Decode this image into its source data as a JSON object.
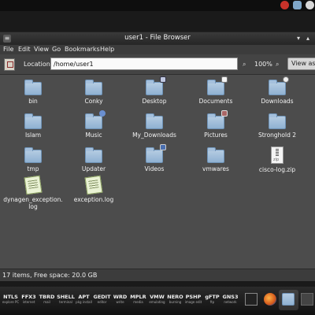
{
  "window": {
    "title": "user1 - File Browser",
    "minimize_glyph": "▾",
    "maximize_glyph": "▴",
    "menu_glyph": "≡"
  },
  "menu": [
    "File",
    "Edit",
    "View",
    "Go",
    "Bookmarks",
    "Help"
  ],
  "location": {
    "label": "Location:",
    "value": "/home/user1",
    "zoom_out": "⌕",
    "zoom_in": "⌕",
    "zoom": "100%",
    "view_button": "View as Icons"
  },
  "items": [
    {
      "label": "bin",
      "type": "folder"
    },
    {
      "label": "Conky",
      "type": "folder"
    },
    {
      "label": "Desktop",
      "type": "folder"
    },
    {
      "label": "Documents",
      "type": "folder"
    },
    {
      "label": "Downloads",
      "type": "folder"
    },
    {
      "label": "Islam",
      "type": "folder"
    },
    {
      "label": "Music",
      "type": "folder"
    },
    {
      "label": "My_Downloads",
      "type": "folder"
    },
    {
      "label": "Pictures",
      "type": "folder"
    },
    {
      "label": "Stronghold 2",
      "type": "folder"
    },
    {
      "label": "tmp",
      "type": "folder"
    },
    {
      "label": "Updater",
      "type": "folder"
    },
    {
      "label": "Videos",
      "type": "folder"
    },
    {
      "label": "vmwares",
      "type": "folder"
    },
    {
      "label": "cisco-log.zip",
      "type": "zip"
    },
    {
      "label": "dynagen_exception.\nlog",
      "type": "log"
    },
    {
      "label": "exception.log",
      "type": "log"
    }
  ],
  "status": "17 items, Free space: 20.0 GB",
  "taskbar": {
    "launchers": [
      {
        "name": "NTLS",
        "sub": "explore PC"
      },
      {
        "name": "FFX3",
        "sub": "internet"
      },
      {
        "name": "TBRD",
        "sub": "mail"
      },
      {
        "name": "SHELL",
        "sub": "terminal"
      },
      {
        "name": "APT",
        "sub": "pkg install"
      },
      {
        "name": "GEDIT",
        "sub": "editor"
      },
      {
        "name": "WRD",
        "sub": "write"
      },
      {
        "name": "MPLR",
        "sub": "media"
      },
      {
        "name": "VMW",
        "sub": "emulating"
      },
      {
        "name": "NERO",
        "sub": "burning"
      },
      {
        "name": "PSHP",
        "sub": "image edit"
      },
      {
        "name": "gFTP",
        "sub": "ftp"
      },
      {
        "name": "GNS3",
        "sub": "network"
      }
    ]
  }
}
